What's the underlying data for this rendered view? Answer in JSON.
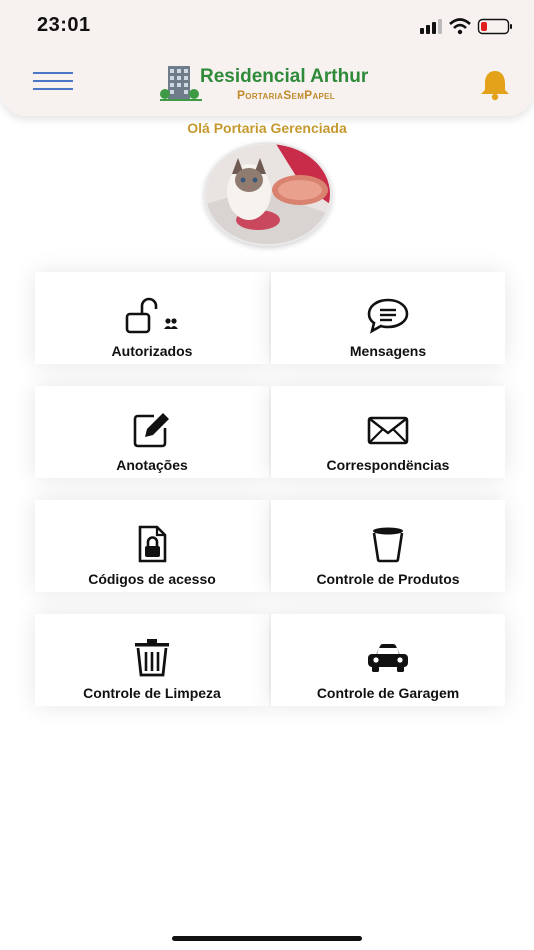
{
  "status_bar": {
    "time": "23:01"
  },
  "header": {
    "logo_title": "Residencial Arthur",
    "logo_subtitle": "PortariaSemPapel",
    "menu_icon": "hamburger-icon",
    "bell_icon": "bell-icon"
  },
  "greeting": "Olá Portaria Gerenciada",
  "colors": {
    "accent": "#c6992e",
    "header_bg": "#f7f2f0",
    "logo_green": "#2f8a3a",
    "menu_blue": "#4a78c6",
    "bell": "#e3a21a"
  },
  "menu": {
    "items": [
      {
        "label": "Autorizados",
        "icon": "unlock-people-icon"
      },
      {
        "label": "Mensagens",
        "icon": "chat-icon"
      },
      {
        "label": "Anotações",
        "icon": "edit-icon"
      },
      {
        "label": "Correspondëncias",
        "icon": "envelope-icon"
      },
      {
        "label": "Códigos de acesso",
        "icon": "lock-file-icon"
      },
      {
        "label": "Controle de Produtos",
        "icon": "cup-icon"
      },
      {
        "label": "Controle de Limpeza",
        "icon": "trash-icon"
      },
      {
        "label": "Controle de Garagem",
        "icon": "car-icon"
      }
    ]
  }
}
